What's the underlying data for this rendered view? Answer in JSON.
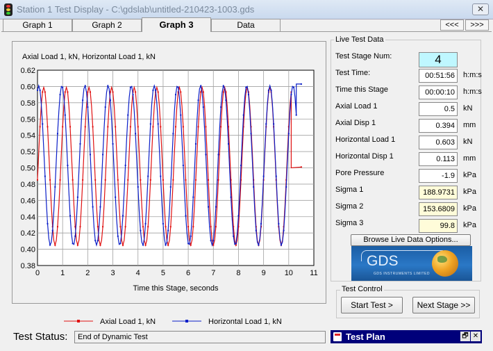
{
  "window": {
    "title": "Station 1 Test Display - C:\\gdslab\\untitled-210423-1003.gds",
    "close_glyph": "✕"
  },
  "tabs": [
    {
      "label": "Graph 1",
      "active": false
    },
    {
      "label": "Graph 2",
      "active": false
    },
    {
      "label": "Graph 3",
      "active": true
    },
    {
      "label": "Data",
      "active": false
    }
  ],
  "nav": {
    "prev": "<<<",
    "next": ">>>"
  },
  "chart_data": {
    "type": "line",
    "title": "Axial Load 1, kN, Horizontal Load 1, kN",
    "xlabel": "Time this Stage, seconds",
    "ylabel": "",
    "xlim": [
      0,
      11
    ],
    "ylim": [
      0.38,
      0.62
    ],
    "x_ticks": [
      "0",
      "1",
      "2",
      "3",
      "4",
      "5",
      "6",
      "7",
      "8",
      "9",
      "10",
      "11"
    ],
    "y_ticks": [
      "0.38",
      "0.40",
      "0.42",
      "0.44",
      "0.46",
      "0.48",
      "0.50",
      "0.52",
      "0.54",
      "0.56",
      "0.58",
      "0.60",
      "0.62"
    ],
    "grid": true,
    "legend_position": "bottom",
    "series": [
      {
        "name": "Axial Load 1, kN",
        "color": "#e01010",
        "cycle": {
          "x_min_first": 0.72,
          "x_max_first": 0.25,
          "period": 0.9,
          "y_min": 0.405,
          "y_max": 0.599,
          "x_end": 10.1
        },
        "tail": [
          [
            10.1,
            0.5
          ],
          [
            10.5,
            0.501
          ]
        ]
      },
      {
        "name": "Horizontal Load 1, kN",
        "color": "#0a1ec8",
        "cycle": {
          "x_min_first": 0.55,
          "x_max_first": 0.05,
          "period": 0.92,
          "y_min": 0.405,
          "y_max": 0.601,
          "x_end": 10.3
        },
        "tail": [
          [
            10.3,
            0.603
          ],
          [
            10.5,
            0.603
          ]
        ]
      }
    ]
  },
  "live_data": {
    "title": "Live Test Data",
    "rows": [
      {
        "label": "Test Stage Num:",
        "value": "4",
        "unit": ""
      },
      {
        "label": "Test Time:",
        "value": "00:51:56",
        "unit": "h:m:s"
      },
      {
        "label": "Time this Stage",
        "value": "00:00:10",
        "unit": "h:m:s"
      },
      {
        "label": "Axial Load 1",
        "value": "0.5",
        "unit": "kN"
      },
      {
        "label": "Axial Disp 1",
        "value": "0.394",
        "unit": "mm"
      },
      {
        "label": "Horizontal Load 1",
        "value": "0.603",
        "unit": "kN"
      },
      {
        "label": "Horizontal Disp 1",
        "value": "0.113",
        "unit": "mm"
      },
      {
        "label": "Pore Pressure",
        "value": "-1.9",
        "unit": "kPa"
      },
      {
        "label": "Sigma 1",
        "value": "188.9731",
        "unit": "kPa"
      },
      {
        "label": "Sigma 2",
        "value": "153.6809",
        "unit": "kPa"
      },
      {
        "label": "Sigma 3",
        "value": "99.8",
        "unit": "kPa"
      }
    ],
    "browse_button": "Browse Live Data Options...",
    "logo": {
      "text": "GDS",
      "subtext": "GDS INSTRUMENTS LIMITED"
    }
  },
  "test_control": {
    "title": "Test Control",
    "start_button": "Start Test >",
    "next_stage_button": "Next Stage >>"
  },
  "status": {
    "label": "Test Status:",
    "value": "End of Dynamic Test"
  },
  "test_plan": {
    "title": "Test Plan",
    "restore_glyph": "🗗",
    "close_glyph": "✕"
  }
}
